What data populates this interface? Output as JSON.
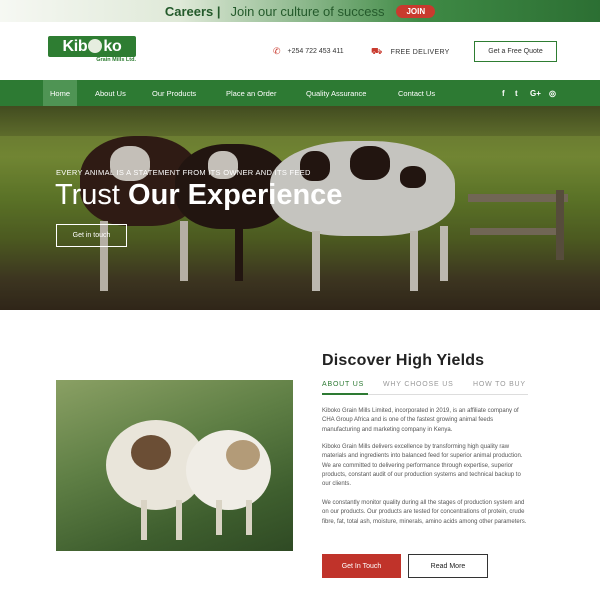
{
  "topbar": {
    "careers": "Careers |",
    "culture": "Join our culture of success",
    "join": "JOIN"
  },
  "header": {
    "logo_name_left": "Kib",
    "logo_name_right": "ko",
    "logo_sub": "Grain Mills Ltd.",
    "phone": "+254 722 453 411",
    "delivery": "FREE DELIVERY",
    "quote_label": "Get a Free Quote"
  },
  "nav": {
    "items": [
      {
        "label": "Home",
        "active": true
      },
      {
        "label": "About Us"
      },
      {
        "label": "Our Products"
      },
      {
        "label": "Place an Order"
      },
      {
        "label": "Quality Assurance"
      },
      {
        "label": "Contact Us"
      }
    ],
    "social": [
      {
        "icon": "facebook-icon",
        "glyph": "f"
      },
      {
        "icon": "twitter-icon",
        "glyph": "t"
      },
      {
        "icon": "google-plus-icon",
        "glyph": "G+"
      },
      {
        "icon": "instagram-icon",
        "glyph": "◎"
      }
    ]
  },
  "hero": {
    "tagline": "EVERY ANIMAL IS A STATEMENT FROM ITS OWNER AND ITS FEED",
    "headline_light": "Trust",
    "headline_bold": "Our Experience",
    "button": "Get in touch"
  },
  "about": {
    "title": "Discover High Yields",
    "tabs": [
      {
        "label": "ABOUT US",
        "active": true
      },
      {
        "label": "WHY CHOOSE US"
      },
      {
        "label": "HOW TO BUY"
      }
    ],
    "paragraphs": [
      "Kiboko Grain Mills Limited, incorporated in 2019, is an affiliate company of CHA Group Africa and is one of the fastest growing animal feeds manufacturing and marketing company in Kenya.",
      "Kiboko Grain Mills delivers excellence by transforming high quality raw materials and ingredients into balanced feed for superior animal production. We are committed to delivering performance through expertise, superior products, constant audit of our production systems and technical backup to our clients.",
      "We constantly monitor quality during all the stages of production system and on our products. Our products are tested for concentrations of protein, crude fibre, fat, total ash, moisture, minerals, amino acids among other parameters."
    ],
    "btn_primary": "Get In Touch",
    "btn_secondary": "Read More"
  },
  "colors": {
    "brand_green": "#2d7a33",
    "accent_red": "#c0332a"
  }
}
